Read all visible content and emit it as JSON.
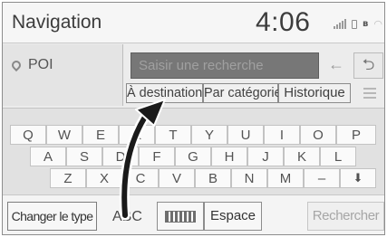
{
  "header": {
    "title": "Navigation",
    "time": "4:06"
  },
  "status_icons": [
    "signal-bars-icon",
    "phone-icon",
    "bluetooth-icon",
    "wifi-icon"
  ],
  "left_panel": {
    "poi_label": "POI",
    "poi_icon": "map-pin-icon"
  },
  "search": {
    "placeholder": "Saisir une recherche",
    "back_icon": "←",
    "return_icon": "⮌"
  },
  "tabs": [
    {
      "label": "À destination"
    },
    {
      "label": "Par catégorie"
    },
    {
      "label": "Historique"
    }
  ],
  "keyboard": {
    "row1": [
      "Q",
      "W",
      "E",
      "R",
      "T",
      "Y",
      "U",
      "I",
      "O",
      "P"
    ],
    "row2": [
      "A",
      "S",
      "D",
      "F",
      "G",
      "H",
      "J",
      "K",
      "L"
    ],
    "row3": [
      "Z",
      "X",
      "C",
      "V",
      "B",
      "N",
      "M",
      "–",
      "⬇"
    ]
  },
  "bottom_bar": {
    "change_type": "Changer le type",
    "abc": "ABC",
    "space": "Espace",
    "search": "Rechercher"
  },
  "colors": {
    "search_field": "#777777",
    "keyboard_bg": "#e1e1e1",
    "callout": "#1a1a1a"
  }
}
